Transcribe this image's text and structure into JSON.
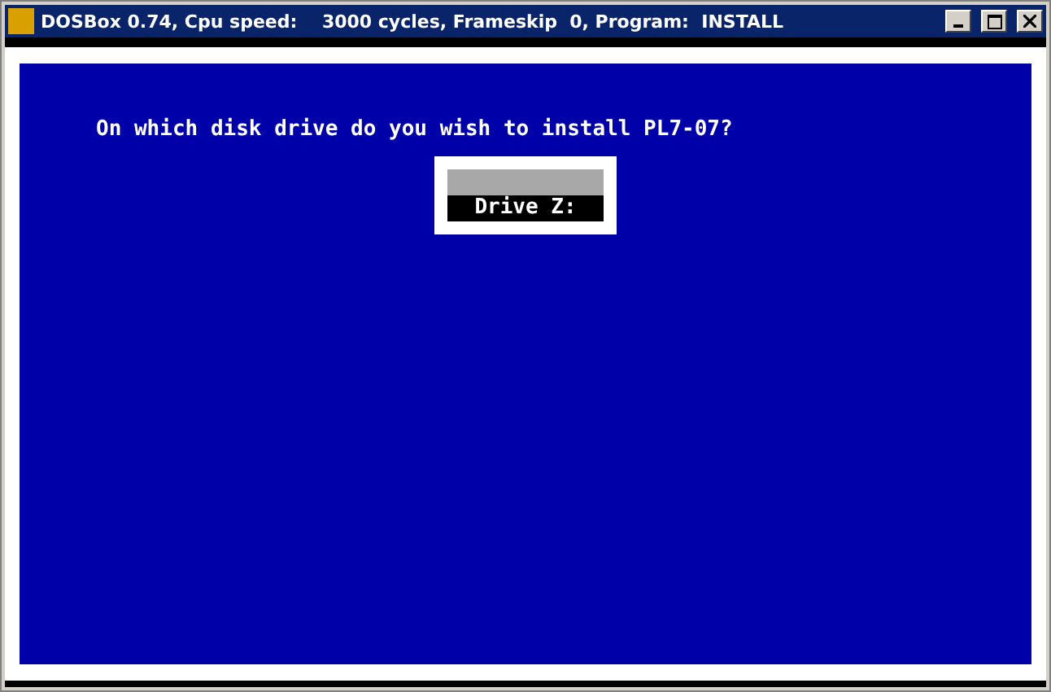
{
  "window": {
    "title": "DOSBox 0.74, Cpu speed:    3000 cycles, Frameskip  0, Program:  INSTALL"
  },
  "screen": {
    "prompt": "On which disk drive do you wish to install PL7-07?",
    "drives": [
      {
        "label": "Drive Z:",
        "selected": true
      }
    ]
  }
}
